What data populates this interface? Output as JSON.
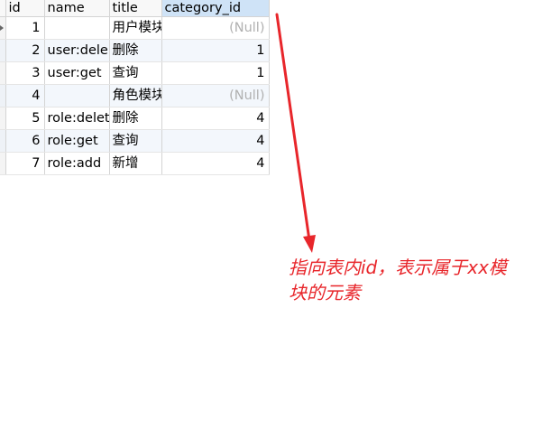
{
  "table": {
    "columns": [
      "id",
      "name",
      "title",
      "category_id"
    ],
    "rows": [
      {
        "id": "1",
        "name": "",
        "title": "用户模块",
        "category_id": "(Null)"
      },
      {
        "id": "2",
        "name": "user:dele",
        "title": "删除",
        "category_id": "1"
      },
      {
        "id": "3",
        "name": "user:get",
        "title": "查询",
        "category_id": "1"
      },
      {
        "id": "4",
        "name": "",
        "title": "角色模块",
        "category_id": "(Null)"
      },
      {
        "id": "5",
        "name": "role:delet",
        "title": "删除",
        "category_id": "4"
      },
      {
        "id": "6",
        "name": "role:get",
        "title": "查询",
        "category_id": "4"
      },
      {
        "id": "7",
        "name": "role:add",
        "title": "新增",
        "category_id": "4"
      }
    ]
  },
  "annotation": {
    "text": "指向表内id，表示属于xx模块的元素",
    "color": "#e8262b"
  },
  "colors": {
    "header_highlight": "#cfe3f7",
    "null_text": "#b0b0b0",
    "alt_row": "#f3f7fc"
  }
}
